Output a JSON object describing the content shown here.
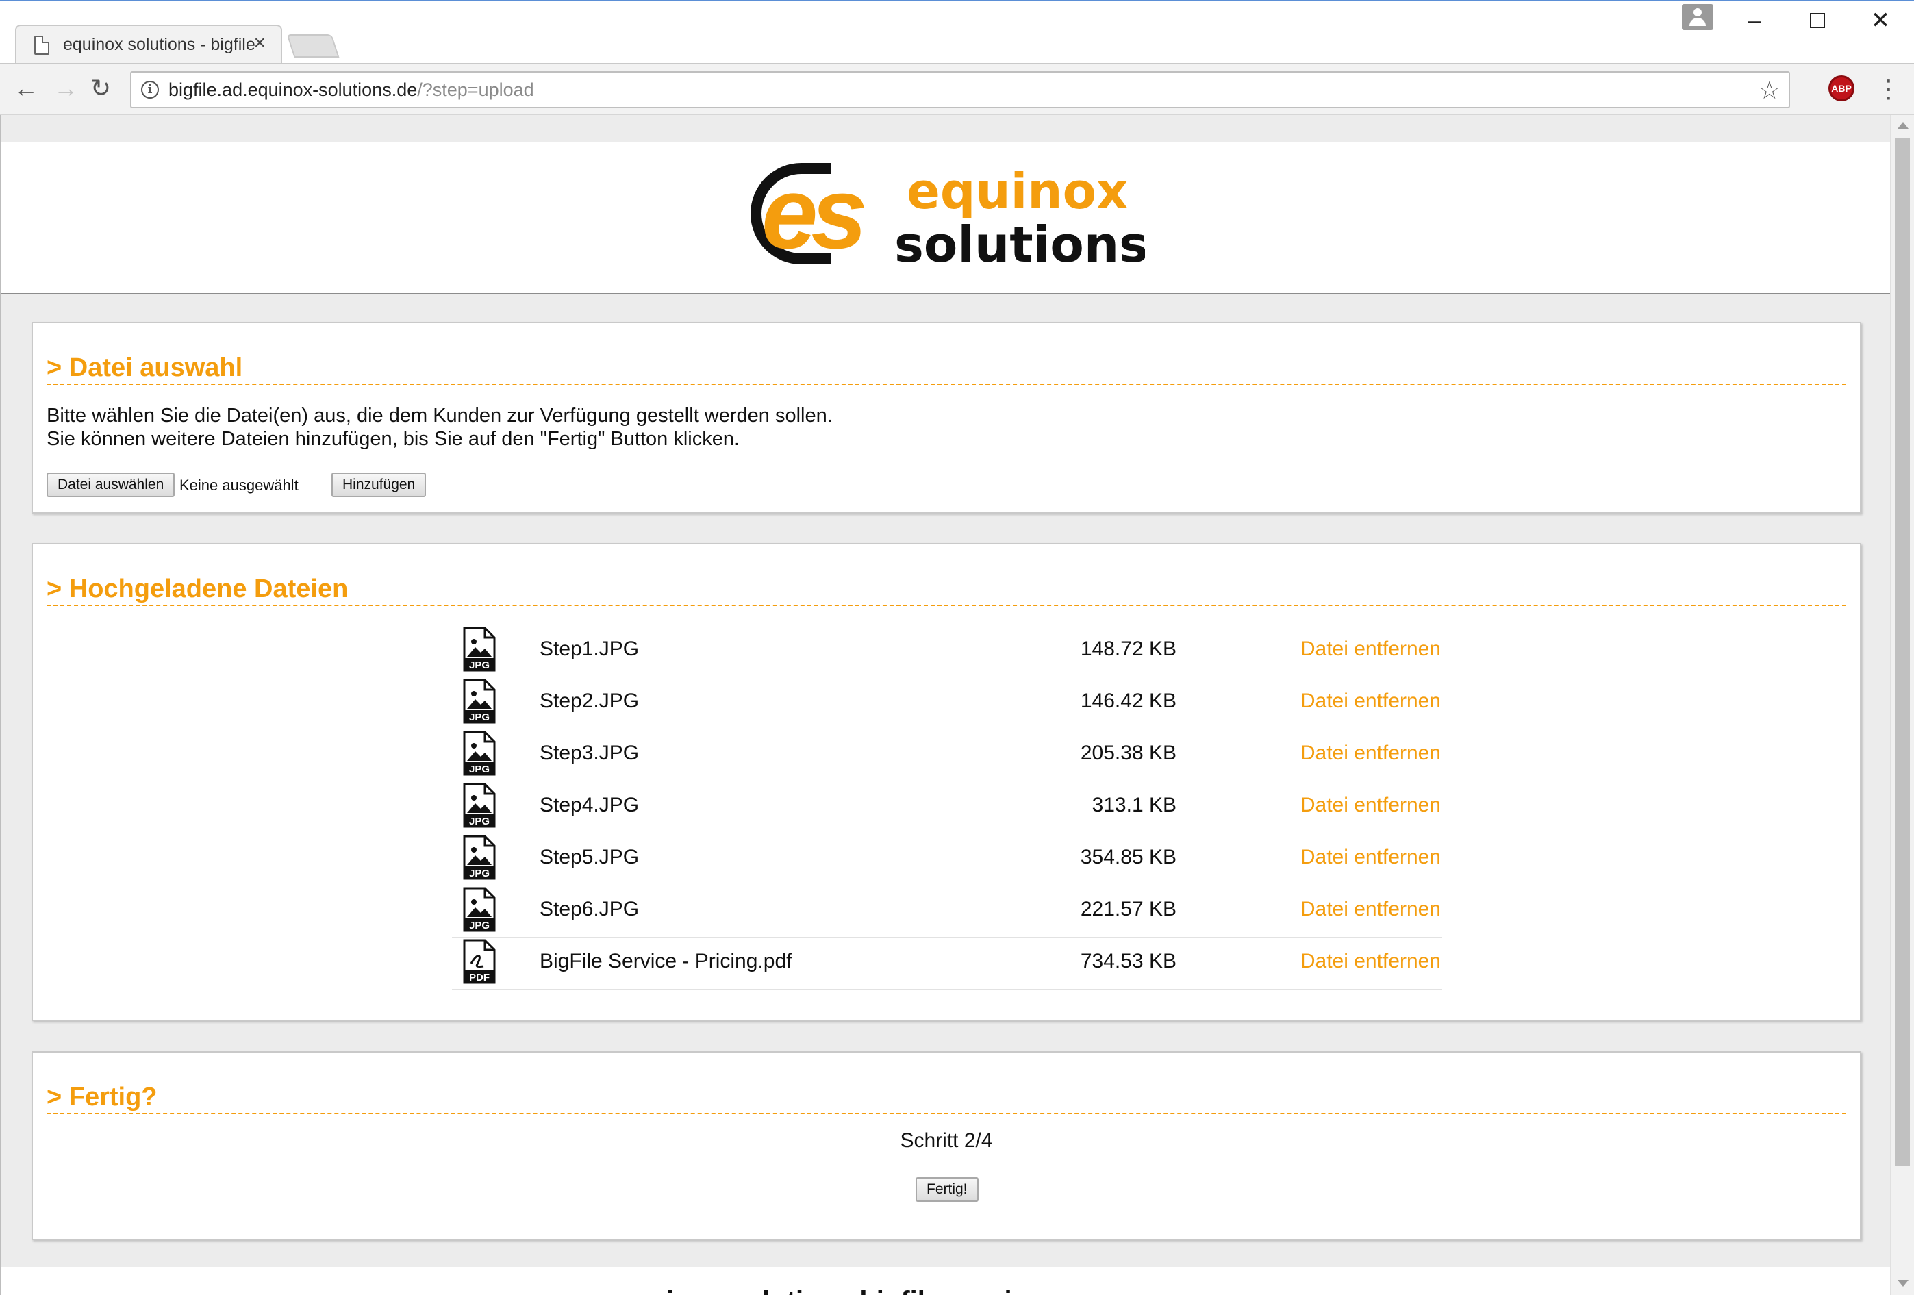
{
  "browser": {
    "tab_title": "equinox solutions - bigfile",
    "tab_close": "×",
    "url_host": "bigfile.ad.equinox-solutions.de",
    "url_path": "/?step=upload",
    "icons": [
      "page-icon",
      "close-icon",
      "back-arrow-icon",
      "forward-arrow-icon",
      "reload-icon",
      "info-icon",
      "star-icon",
      "adblock-plus-icon",
      "kebab-menu-icon",
      "profile-icon",
      "minimize-icon",
      "maximize-icon",
      "window-close-icon"
    ],
    "adblock_label": "ABP"
  },
  "logo": {
    "word1": "equinox",
    "word2": "solutions",
    "monogram": "es",
    "colors": {
      "orange": "#f49d0e",
      "black": "#111111"
    }
  },
  "section_select": {
    "title": "> Datei auswahl",
    "line1": "Bitte wählen Sie die Datei(en) aus, die dem Kunden zur Verfügung gestellt werden sollen.",
    "line2": "Sie können weitere Dateien hinzufügen, bis Sie auf den \"Fertig\" Button klicken.",
    "choose_button": "Datei auswählen",
    "no_file_text": "Keine ausgewählt",
    "add_button": "Hinzufügen"
  },
  "section_uploaded": {
    "title": "> Hochgeladene Dateien",
    "remove_label": "Datei entfernen",
    "files": [
      {
        "name": "Step1.JPG",
        "size": "148.72 KB",
        "type": "JPG"
      },
      {
        "name": "Step2.JPG",
        "size": "146.42 KB",
        "type": "JPG"
      },
      {
        "name": "Step3.JPG",
        "size": "205.38 KB",
        "type": "JPG"
      },
      {
        "name": "Step4.JPG",
        "size": "313.1 KB",
        "type": "JPG"
      },
      {
        "name": "Step5.JPG",
        "size": "354.85 KB",
        "type": "JPG"
      },
      {
        "name": "Step6.JPG",
        "size": "221.57 KB",
        "type": "JPG"
      },
      {
        "name": "BigFile Service - Pricing.pdf",
        "size": "734.53 KB",
        "type": "PDF"
      }
    ]
  },
  "section_done": {
    "title": "> Fertig?",
    "step_text": "Schritt 2/4",
    "done_button": "Fertig!"
  },
  "footer": {
    "partial_text": "equinox solutions bigfile service"
  },
  "colors": {
    "accent": "#f49d0e",
    "page_bg": "#ececec"
  }
}
